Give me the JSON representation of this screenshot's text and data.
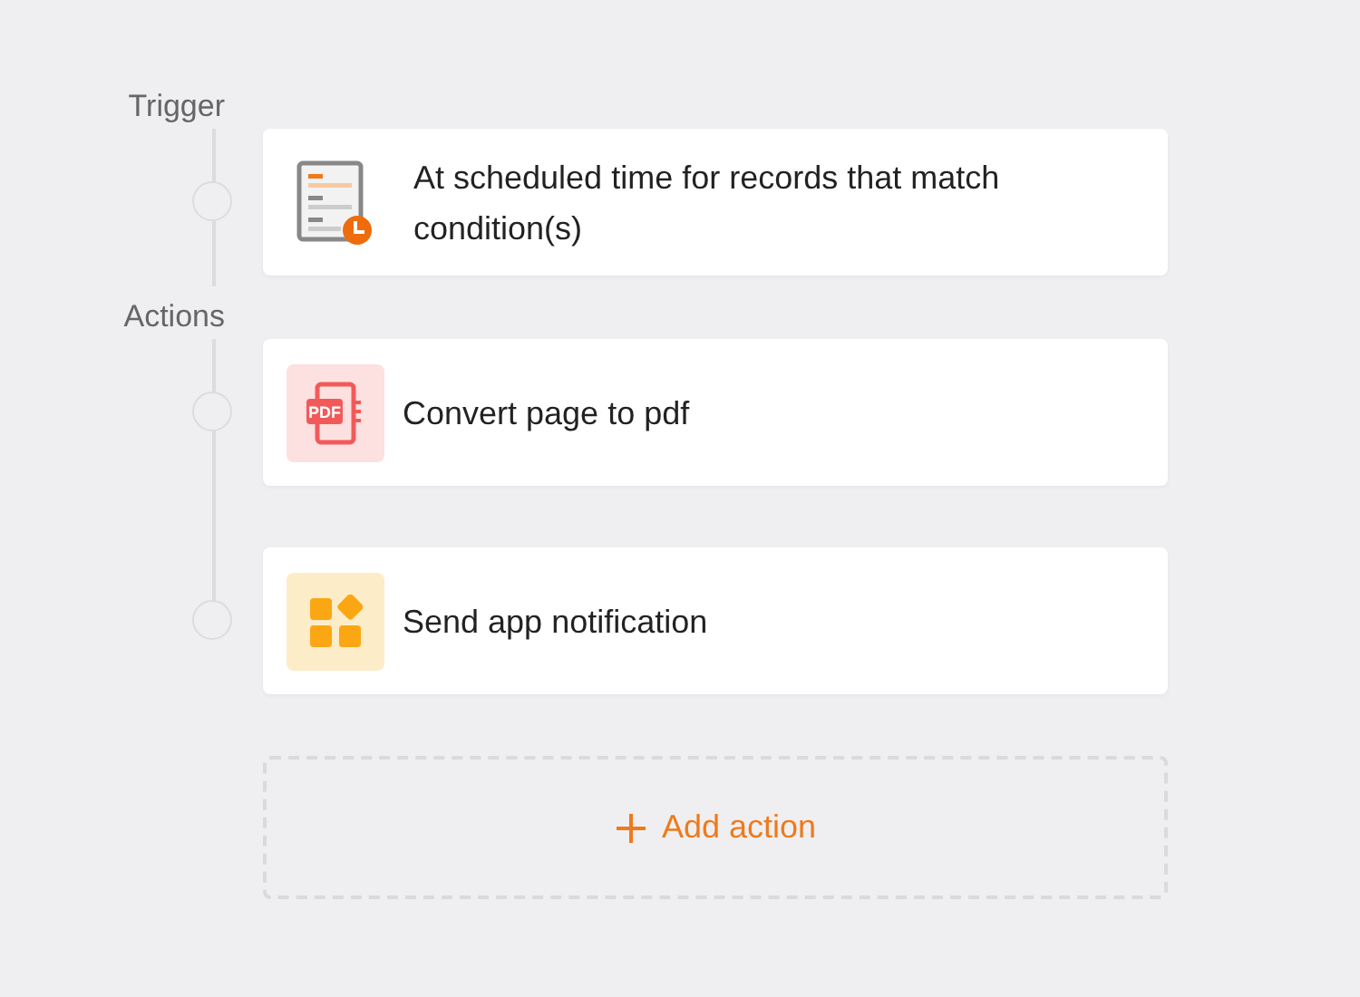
{
  "sections": [
    {
      "label": "Trigger",
      "steps": [
        {
          "kind": "trigger",
          "text": "At scheduled time for records that match condition(s)"
        }
      ]
    },
    {
      "label": "Actions",
      "steps": [
        {
          "kind": "pdf",
          "icon_text": "PDF",
          "text": "Convert page to pdf"
        },
        {
          "kind": "notification",
          "text": "Send app notification"
        }
      ]
    }
  ],
  "add_action": {
    "label": "Add action"
  }
}
